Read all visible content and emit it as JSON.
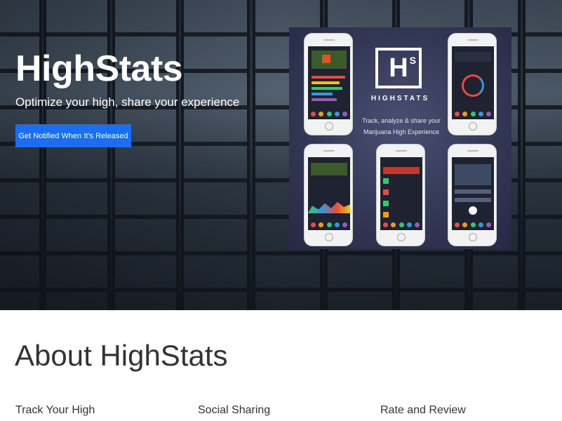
{
  "hero": {
    "title": "HighStats",
    "tagline": "Optimize your high, share your experience",
    "cta_label": "Get Notified When It's Released"
  },
  "promo": {
    "logo_letter": "H",
    "logo_sup": "S",
    "wordmark": "HIGHSTATS",
    "tagline_line1": "Track, analyze & share your",
    "tagline_line2": "Marijuana High Experience"
  },
  "about": {
    "heading": "About HighStats",
    "features": [
      "Track Your High",
      "Social Sharing",
      "Rate and Review"
    ]
  },
  "colors": {
    "cta": "#1a6ef5",
    "promo_bg": "#343857",
    "text": "#333333"
  }
}
